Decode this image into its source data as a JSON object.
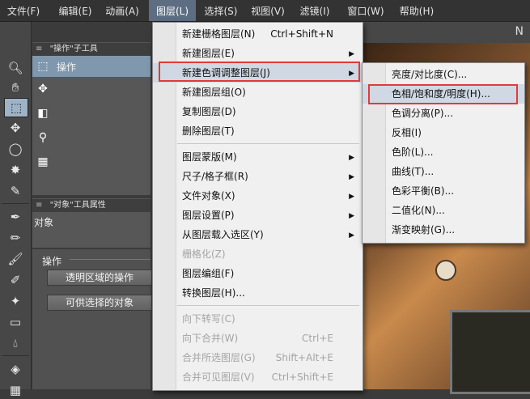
{
  "menubar": [
    {
      "label": "文件(F)"
    },
    {
      "label": "编辑(E)"
    },
    {
      "label": "动画(A)"
    },
    {
      "label": "图层(L)",
      "active": true
    },
    {
      "label": "选择(S)"
    },
    {
      "label": "视图(V)"
    },
    {
      "label": "滤镜(I)"
    },
    {
      "label": "窗口(W)"
    },
    {
      "label": "帮助(H)"
    }
  ],
  "subtool_panel": {
    "title": "\"操作\"子工具",
    "items": [
      {
        "label": "操作",
        "icon": "object-arrow-icon",
        "selected": true
      },
      {
        "label": "",
        "icon": "layer-move-icon",
        "selected": false
      },
      {
        "label": "",
        "icon": "light-table-icon",
        "selected": false
      },
      {
        "label": "",
        "icon": "pin-icon",
        "selected": false
      },
      {
        "label": "",
        "icon": "grid-icon",
        "selected": false
      }
    ]
  },
  "properties_panel": {
    "title": "\"对象\"工具属性",
    "object_label": "对象",
    "section_label": "操作",
    "buttons": [
      "透明区域的操作",
      "可供选择的对象"
    ]
  },
  "layer_menu": {
    "items": [
      {
        "label": "新建栅格图层(N)",
        "shortcut": "Ctrl+Shift+N",
        "submenu": false,
        "disabled": false
      },
      {
        "label": "新建图层(E)",
        "shortcut": "",
        "submenu": true,
        "disabled": false
      },
      {
        "label": "新建色调调整图层(J)",
        "shortcut": "",
        "submenu": true,
        "disabled": false,
        "highlighted": true
      },
      {
        "label": "新建图层组(O)",
        "shortcut": "",
        "submenu": false,
        "disabled": false
      },
      {
        "label": "复制图层(D)",
        "shortcut": "",
        "submenu": false,
        "disabled": false
      },
      {
        "label": "删除图层(T)",
        "shortcut": "",
        "submenu": false,
        "disabled": false
      },
      {
        "separator": true
      },
      {
        "label": "图层蒙版(M)",
        "shortcut": "",
        "submenu": true,
        "disabled": false
      },
      {
        "label": "尺子/格子框(R)",
        "shortcut": "",
        "submenu": true,
        "disabled": false
      },
      {
        "label": "文件对象(X)",
        "shortcut": "",
        "submenu": true,
        "disabled": false
      },
      {
        "label": "图层设置(P)",
        "shortcut": "",
        "submenu": true,
        "disabled": false
      },
      {
        "label": "从图层载入选区(Y)",
        "shortcut": "",
        "submenu": true,
        "disabled": false
      },
      {
        "label": "栅格化(Z)",
        "shortcut": "",
        "submenu": false,
        "disabled": true
      },
      {
        "label": "图层编组(F)",
        "shortcut": "",
        "submenu": false,
        "disabled": false
      },
      {
        "label": "转换图层(H)...",
        "shortcut": "",
        "submenu": false,
        "disabled": false
      },
      {
        "separator": true
      },
      {
        "label": "向下转写(C)",
        "shortcut": "",
        "submenu": false,
        "disabled": true
      },
      {
        "label": "向下合并(W)",
        "shortcut": "Ctrl+E",
        "submenu": false,
        "disabled": true
      },
      {
        "label": "合并所选图层(G)",
        "shortcut": "Shift+Alt+E",
        "submenu": false,
        "disabled": true
      },
      {
        "label": "合并可见图层(V)",
        "shortcut": "Ctrl+Shift+E",
        "submenu": false,
        "disabled": true
      }
    ]
  },
  "tone_submenu": {
    "items": [
      {
        "label": "亮度/对比度(C)..."
      },
      {
        "label": "色相/饱和度/明度(H)...",
        "highlighted": true
      },
      {
        "label": "色调分离(P)..."
      },
      {
        "label": "反相(I)"
      },
      {
        "label": "色阶(L)..."
      },
      {
        "label": "曲线(T)..."
      },
      {
        "label": "色彩平衡(B)..."
      },
      {
        "label": "二值化(N)..."
      },
      {
        "label": "渐变映射(G)..."
      }
    ]
  },
  "annotation_color": "#e23a3a"
}
